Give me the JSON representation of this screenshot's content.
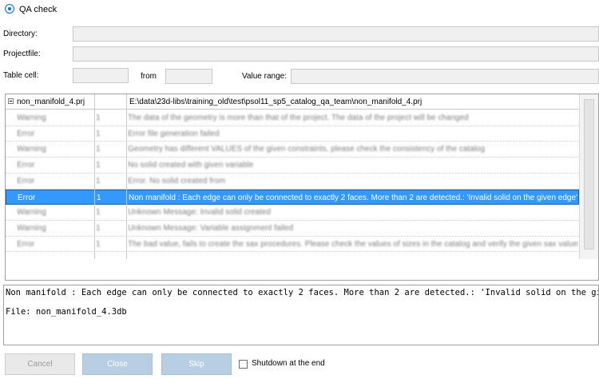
{
  "window": {
    "title": "QA check",
    "icon": "app-qa-icon"
  },
  "form": {
    "directory_label": "Directory:",
    "directory_value": "",
    "projectfile_label": "Projectfile:",
    "projectfile_value": "",
    "tablecell_label": "Table cell:",
    "tablecell_value": "",
    "from_label": "from",
    "from_value": "",
    "valuerange_label": "Value range:",
    "valuerange_value": ""
  },
  "grid": {
    "header": {
      "name": "non_manifold_4.prj",
      "path": "E:\\data\\23d-libs\\training_old\\test\\psol11_sp5_catalog_qa_team\\non_manifold_4.prj"
    },
    "rows": [
      {
        "type": "Warning",
        "count": "1",
        "message": "The data of the geometry is more than that of the project. The data of the project will be changed",
        "selected": false,
        "blurred": true
      },
      {
        "type": "Error",
        "count": "1",
        "message": "Error file generation failed",
        "selected": false,
        "blurred": true
      },
      {
        "type": "Warning",
        "count": "1",
        "message": "Geometry has different VALUES of the given constraints, please check the consistency of the catalog",
        "selected": false,
        "blurred": true
      },
      {
        "type": "Error",
        "count": "1",
        "message": "No solid created with given variable",
        "selected": false,
        "blurred": true
      },
      {
        "type": "Error",
        "count": "1",
        "message": "Error. No solid created from",
        "selected": false,
        "blurred": true
      },
      {
        "type": "Error",
        "count": "1",
        "message": "Non manifold : Each edge can only be connected to exactly 2 faces. More than 2 are detected.: 'Invalid solid on the given edge'",
        "selected": true,
        "blurred": false
      },
      {
        "type": "Warning",
        "count": "1",
        "message": "Unknown Message: Invalid solid created",
        "selected": false,
        "blurred": true
      },
      {
        "type": "Warning",
        "count": "1",
        "message": "Unknown Message: Variable assignment failed",
        "selected": false,
        "blurred": true
      },
      {
        "type": "Error",
        "count": "1",
        "message": "The bad value, fails to create the sax procedures. Please check the values of sizes in the catalog and verify the given sax values",
        "selected": false,
        "blurred": true
      }
    ]
  },
  "message_box": {
    "line1": "Non manifold : Each edge can only be connected to exactly 2 faces. More than 2 are detected.: 'Invalid solid on the given edge'",
    "line2": "",
    "line3": "File: non_manifold_4.3db"
  },
  "buttons": {
    "cancel": "Cancel",
    "close": "Close",
    "skip": "Skip",
    "shutdown_label": "Shutdown at the end"
  }
}
